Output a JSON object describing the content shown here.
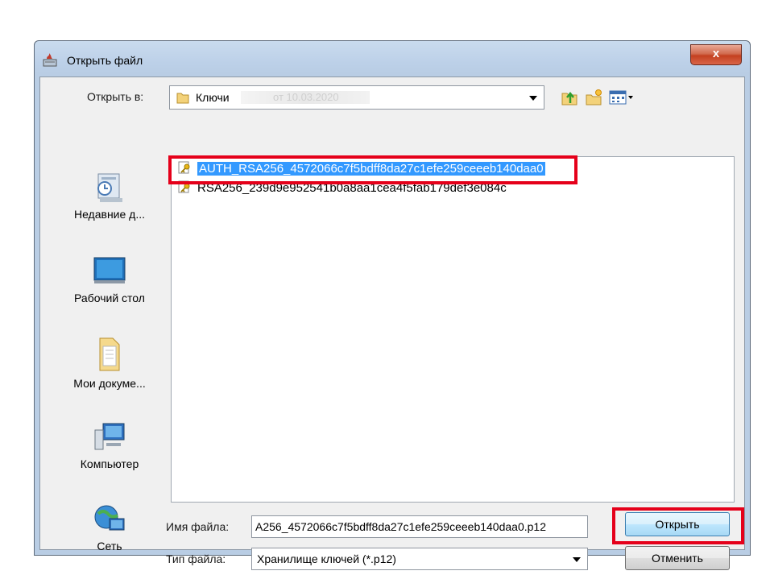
{
  "window": {
    "title": "Открыть файл",
    "close_glyph": "x"
  },
  "toolbar": {
    "look_in_label": "Открыть в:",
    "look_in_value": "Ключи",
    "look_in_hidden": "от 10.03.2020",
    "icons": [
      "up-folder-icon",
      "new-folder-icon",
      "view-menu-icon"
    ]
  },
  "places": [
    {
      "label": "Недавние д...",
      "icon": "recent-documents-icon"
    },
    {
      "label": "Рабочий стол",
      "icon": "desktop-icon"
    },
    {
      "label": "Мои докуме...",
      "icon": "my-documents-icon"
    },
    {
      "label": "Компьютер",
      "icon": "computer-icon"
    },
    {
      "label": "Сеть",
      "icon": "network-icon"
    }
  ],
  "files": [
    {
      "name": "AUTH_RSA256_4572066c7f5bdff8da27c1efe259ceeeb140daa0",
      "selected": true,
      "icon": "key-file-icon"
    },
    {
      "name": "RSA256_239d9e952541b0a8aa1cea4f5fab179def3e084c",
      "selected": false,
      "icon": "key-file-icon"
    }
  ],
  "form": {
    "filename_label": "Имя файла:",
    "filename_value": "А256_4572066c7f5bdff8da27c1efe259ceeeb140daa0.p12",
    "filetype_label": "Тип файла:",
    "filetype_value": "Хранилище ключей (*.p12)",
    "open_button": "Открыть",
    "cancel_button": "Отменить"
  },
  "colors": {
    "highlight": "#e5001a",
    "selection": "#3399ff",
    "frame": "#b9cde4"
  }
}
